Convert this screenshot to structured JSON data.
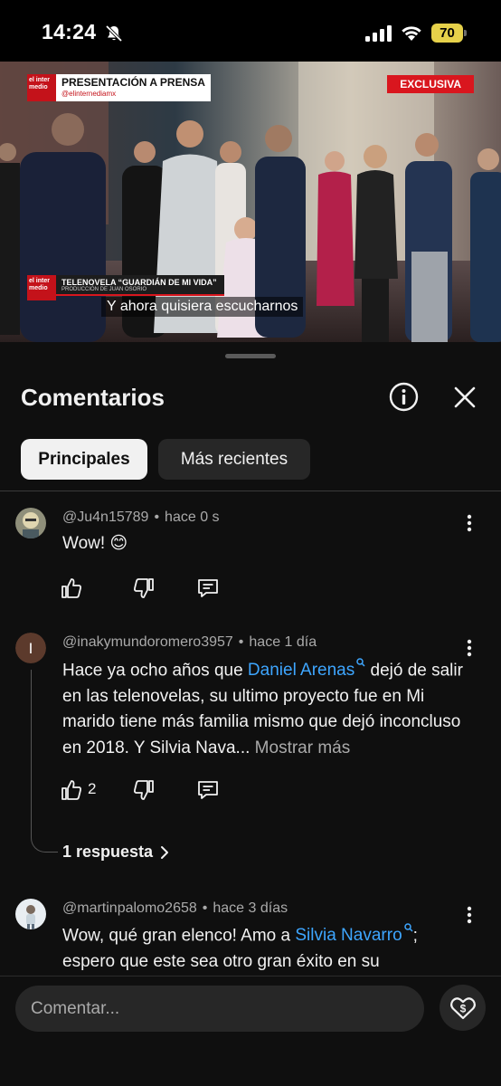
{
  "status_bar": {
    "time": "14:24",
    "battery_level": "70",
    "icons": [
      "bell-off-icon",
      "cellular-signal-icon",
      "wifi-icon",
      "battery-icon"
    ]
  },
  "video": {
    "top_tag": "PRESENTACIÓN A PRENSA",
    "top_handle": "@elinternediamx",
    "logo_text": "el inter medio",
    "badge": "EXCLUSIVA",
    "lower_third_title": "TELENOVELA “GUARDIÁN DE MI VIDA”",
    "lower_third_sub": "PRODUCCIÓN DE JUAN OSORIO",
    "subtitle": "Y ahora quisiera escucharnos"
  },
  "sheet": {
    "title": "Comentarios",
    "chips": [
      {
        "label": "Principales",
        "selected": true
      },
      {
        "label": "Más recientes",
        "selected": false
      }
    ]
  },
  "comments": [
    {
      "author": "@Ju4n15789",
      "time": "hace 0 s",
      "text": "Wow! 😊",
      "likes": ""
    },
    {
      "author": "@inakymundoromero3957",
      "time": "hace 1 día",
      "text_before": "Hace ya ocho años que ",
      "mention": "Daniel Arenas",
      "text_after": " dejó de salir en las telenovelas, su ultimo proyecto fue en Mi marido tiene más familia mismo que dejó inconcluso en 2018. Y Silvia Nava...",
      "more": "Mostrar más",
      "likes": "2",
      "avatar_letter": "I",
      "avatar_color": "#5c3a2c",
      "replies": "1 respuesta"
    },
    {
      "author": "@martinpalomo2658",
      "time": "hace 3 días",
      "text_before": "Wow, qué gran elenco! Amo a ",
      "mention": "Silvia Navarro",
      "text_after": "; espero que este sea otro gran éxito en su"
    }
  ],
  "composer": {
    "placeholder": "Comentar..."
  },
  "colors": {
    "accent_link": "#3ea6ff",
    "sheet_bg": "#0f0f0f",
    "chip_bg": "#272727",
    "broadcast_red": "#d9161e"
  }
}
